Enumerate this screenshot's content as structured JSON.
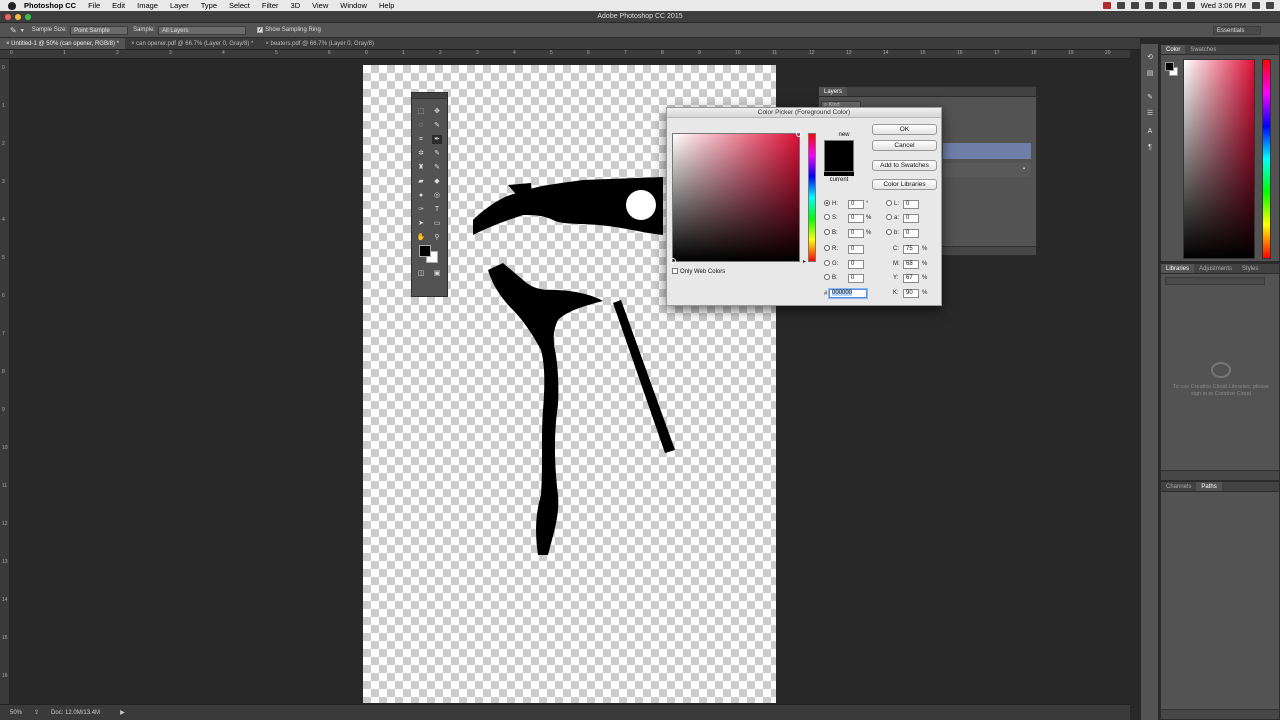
{
  "menubar": {
    "app": "Photoshop CC",
    "items": [
      "File",
      "Edit",
      "Image",
      "Layer",
      "Type",
      "Select",
      "Filter",
      "3D",
      "View",
      "Window",
      "Help"
    ],
    "clock": "Wed 3:06 PM"
  },
  "window": {
    "title": "Adobe Photoshop CC 2015"
  },
  "options": {
    "sample_size_label": "Sample Size:",
    "sample_size_value": "Point Sample",
    "sample_label": "Sample:",
    "sample_value": "All Layers",
    "sampling_ring_label": "Show Sampling Ring",
    "workspace": "Essentials"
  },
  "tabs": [
    "Untitled-1 @ 50% (can opener, RGB/8) *",
    "can opener.pdf @ 66.7% (Layer 0, Gray/8) *",
    "beaters.pdf @ 66.7% (Layer 0, Gray/8)"
  ],
  "ruler": {
    "h": [
      "0",
      "1",
      "2",
      "3",
      "4",
      "5",
      "6",
      "7",
      "8",
      "9",
      "10",
      "11",
      "12",
      "13",
      "14",
      "15",
      "16",
      "17",
      "18",
      "19",
      "20"
    ],
    "v": [
      "0",
      "1",
      "2",
      "3",
      "4",
      "5",
      "6",
      "7",
      "8",
      "9",
      "10",
      "11",
      "12",
      "13",
      "14",
      "15",
      "16"
    ]
  },
  "status": {
    "zoom": "50%",
    "doc": "Doc: 12.0M/13.4M"
  },
  "color_picker": {
    "title": "Color Picker (Foreground Color)",
    "ok": "OK",
    "cancel": "Cancel",
    "add_swatches": "Add to Swatches",
    "color_libraries": "Color Libraries",
    "new_label": "new",
    "current_label": "current",
    "only_web": "Only Web Colors",
    "new_color": "#000000",
    "current_color": "#000000",
    "hue_color": "#dd1038",
    "H": {
      "label": "H:",
      "value": "0",
      "unit": "°"
    },
    "S": {
      "label": "S:",
      "value": "0",
      "unit": "%"
    },
    "Bv": {
      "label": "B:",
      "value": "0",
      "unit": "%"
    },
    "R": {
      "label": "R:",
      "value": "0"
    },
    "G": {
      "label": "G:",
      "value": "0"
    },
    "Bl": {
      "label": "B:",
      "value": "0"
    },
    "L": {
      "label": "L:",
      "value": "0"
    },
    "a": {
      "label": "a:",
      "value": "0"
    },
    "b": {
      "label": "b:",
      "value": "0"
    },
    "C": {
      "label": "C:",
      "value": "75",
      "unit": "%"
    },
    "M": {
      "label": "M:",
      "value": "68",
      "unit": "%"
    },
    "Y": {
      "label": "Y:",
      "value": "67",
      "unit": "%"
    },
    "K": {
      "label": "K:",
      "value": "90",
      "unit": "%"
    },
    "hex_label": "#",
    "hex": "000000"
  },
  "layers": {
    "tab": "Layers",
    "filter": "Kind"
  },
  "color_panel": {
    "tabs": [
      "Color",
      "Swatches"
    ],
    "fg": "#000000",
    "bg": "#ffffff",
    "hue": "#e0113a"
  },
  "libraries_panel": {
    "tabs": [
      "Libraries",
      "Adjustments",
      "Styles"
    ],
    "message": "To use Creative Cloud Libraries, please sign in to Creative Cloud"
  },
  "paths_panel": {
    "tabs": [
      "Channels",
      "Paths"
    ]
  }
}
